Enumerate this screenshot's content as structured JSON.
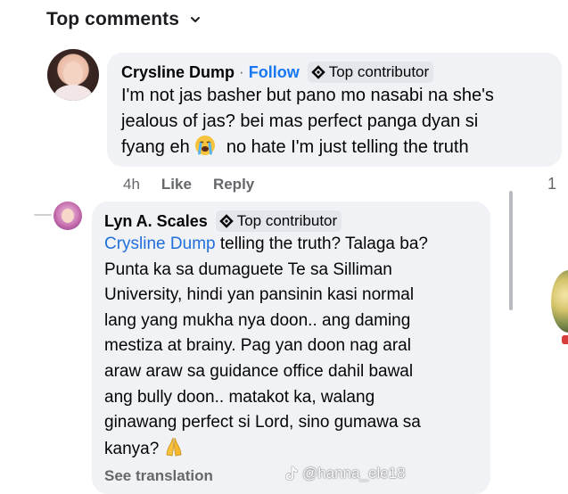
{
  "header": {
    "title": "Top comments",
    "chevron_icon": "chevron-down-icon"
  },
  "comments": [
    {
      "author": "Crysline Dump",
      "separator": "·",
      "follow_label": "Follow",
      "badge": {
        "label": "Top contributor",
        "icon": "top-contributor-icon"
      },
      "text_lines": [
        "I'm not jas basher but pano mo nasabi na she's",
        "jealous of jas? bei mas perfect panga dyan si",
        "fyang eh",
        "no hate I'm just telling the truth"
      ],
      "emoji": "loudly-crying-face",
      "actions": {
        "time": "4h",
        "like": "Like",
        "reply": "Reply"
      },
      "reaction_count": "1"
    },
    {
      "author": "Lyn A. Scales",
      "badge": {
        "label": "Top contributor",
        "icon": "top-contributor-icon"
      },
      "mention": "Crysline Dump",
      "text_after_mention": " telling the truth? Talaga ba?",
      "text_lines": [
        "Punta ka sa dumaguete Te sa Silliman",
        "University, hindi yan pansinin kasi normal",
        "lang yang mukha nya doon.. ang daming",
        "mestiza at brainy. Pag yan doon nag aral",
        "araw araw sa guidance office dahil bawal",
        "ang bully doon.. matakot ka, walang",
        "ginawang perfect si Lord, sino gumawa sa",
        "kanya?"
      ],
      "emoji": "folded-hands",
      "see_translation": "See translation"
    }
  ],
  "watermark": {
    "handle": "@hanna_ele18",
    "icon": "tiktok-icon"
  },
  "colors": {
    "link": "#1877f2",
    "mention": "#216fdb",
    "bubble": "#f0f2f5",
    "muted": "#65676b"
  }
}
